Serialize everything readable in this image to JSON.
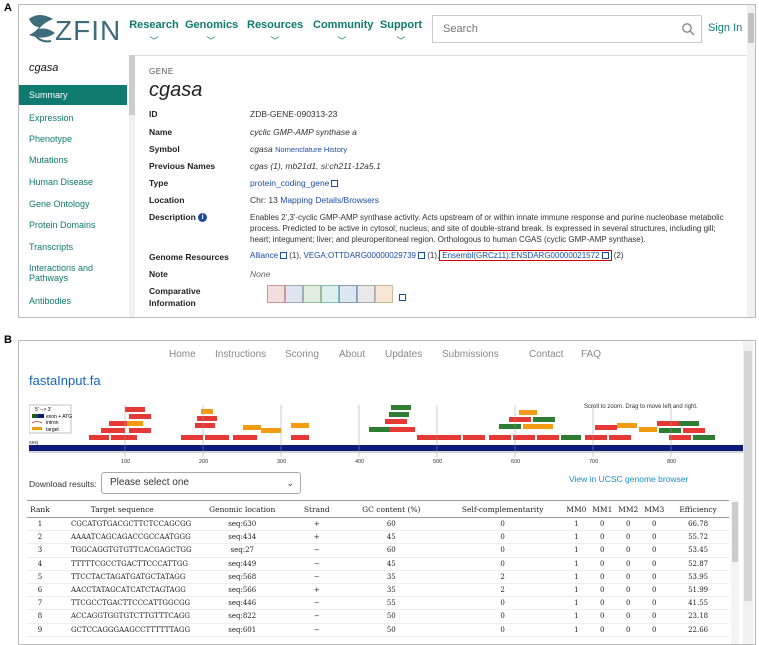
{
  "panel_labels": {
    "a": "A",
    "b": "B"
  },
  "zfin": {
    "logo_text": "ZFIN",
    "nav": [
      {
        "label": "Research"
      },
      {
        "label": "Genomics"
      },
      {
        "label": "Resources"
      },
      {
        "label": "Community"
      },
      {
        "label": "Support"
      }
    ],
    "search_placeholder": "Search",
    "sign_in": "Sign In",
    "sidebar_title": "cgasa",
    "sidebar": [
      "Summary",
      "Expression",
      "Phenotype",
      "Mutations",
      "Human Disease",
      "Gene Ontology",
      "Protein Domains",
      "Transcripts",
      "Interactions and Pathways",
      "Antibodies"
    ],
    "gene_section": "GENE",
    "gene_title": "cgasa",
    "rows": {
      "id_label": "ID",
      "id_value": "ZDB-GENE-090313-23",
      "name_label": "Name",
      "name_value": "cyclic GMP-AMP synthase a",
      "symbol_label": "Symbol",
      "symbol_value": "cgasa",
      "symbol_link": "Nomenclature History",
      "prev_label": "Previous Names",
      "prev_value": "cgas (1), mb21d1, si:ch211-12a5.1",
      "type_label": "Type",
      "type_value": "protein_coding_gene",
      "location_label": "Location",
      "location_prefix": "Chr: 13",
      "location_link": "Mapping Details/Browsers",
      "desc_label": "Description",
      "desc_line1": "Enables 2',3'-cyclic GMP-AMP synthase activity. Acts upstream of or within innate immune response and purine nucleobase metabolic",
      "desc_line2": "process. Predicted to be active in cytosol; nucleus; and site of double-strand break. Is expressed in several structures, including gill;",
      "desc_line3": "heart; integument; liver; and pleuroperitoneal region. Orthologous to human CGAS (cyclic GMP-AMP synthase).",
      "genome_label": "Genome Resources",
      "genome_alliance": "Alliance",
      "genome_alliance_count": "(1),",
      "genome_vega": "VEGA:OTTDARG00000029739",
      "genome_vega_count": "(1),",
      "genome_ensembl": "Ensembl(GRCz11):ENSDARG00000021572",
      "genome_ensembl_count": "(2)",
      "note_label": "Note",
      "note_value": "None",
      "comparative_label": "Comparative Information"
    },
    "comparative_icons": [
      "human-icon",
      "mouse-icon",
      "fly-icon",
      "zebrafish-icon",
      "fish-icon",
      "frog-icon",
      "worm-icon"
    ]
  },
  "chopchop": {
    "nav": [
      "Home",
      "Instructions",
      "Scoring",
      "About",
      "Updates",
      "Submissions",
      "Contact",
      "FAQ"
    ],
    "title": "fastaInput.fa",
    "legend": [
      "5' --> 3'",
      "exon + ATG",
      "intron",
      "target"
    ],
    "zoom_note": "Scroll to zoom. Drag to move left and right.",
    "axis_labels": [
      "seq",
      "100",
      "200",
      "300",
      "400",
      "500",
      "600",
      "700",
      "800"
    ],
    "download_label": "Download results:",
    "download_select": "Please select one",
    "ucsc_link": "View in UCSC genome browser",
    "table": {
      "headers": [
        "Rank",
        "Target sequence",
        "Genomic location",
        "Strand",
        "GC content (%)",
        "Self-complementarity",
        "MM0",
        "MM1",
        "MM2",
        "MM3",
        "Efficiency"
      ],
      "rows": [
        [
          "1",
          "CGCATGTGACGCTTCTCCAGCGG",
          "seq:630",
          "+",
          "60",
          "0",
          "1",
          "0",
          "0",
          "0",
          "66.78"
        ],
        [
          "2",
          "AAAATCAGCAGACCGCCAATGGG",
          "seq:434",
          "+",
          "45",
          "0",
          "1",
          "0",
          "0",
          "0",
          "55.72"
        ],
        [
          "3",
          "TGGCAGGTGTGTTCACGAGCTGG",
          "seq:27",
          "−",
          "60",
          "0",
          "1",
          "0",
          "0",
          "0",
          "53.45"
        ],
        [
          "4",
          "TTTTTCGCCTGACTTCCCATTGG",
          "seq:449",
          "−",
          "45",
          "0",
          "1",
          "0",
          "0",
          "0",
          "52.87"
        ],
        [
          "5",
          "TTCCTACTAGATGATGCTATAGG",
          "seq:568",
          "−",
          "35",
          "2",
          "1",
          "0",
          "0",
          "0",
          "53.95"
        ],
        [
          "6",
          "AACCTATAGCATCATCTAGTAGG",
          "seq:566",
          "+",
          "35",
          "2",
          "1",
          "0",
          "0",
          "0",
          "51.99"
        ],
        [
          "7",
          "TTCGCCTGACTTCCCATTGGCGG",
          "seq:446",
          "−",
          "55",
          "0",
          "1",
          "0",
          "0",
          "0",
          "41.55"
        ],
        [
          "8",
          "ACCAGGTGGTGTCTTGTTTCAGG",
          "seq:822",
          "−",
          "50",
          "0",
          "1",
          "0",
          "0",
          "0",
          "23.18"
        ],
        [
          "9",
          "GCTCCAGGGAAGCCTTTTTTAGG",
          "seq:601",
          "−",
          "50",
          "0",
          "1",
          "0",
          "0",
          "0",
          "22.66"
        ]
      ]
    }
  }
}
